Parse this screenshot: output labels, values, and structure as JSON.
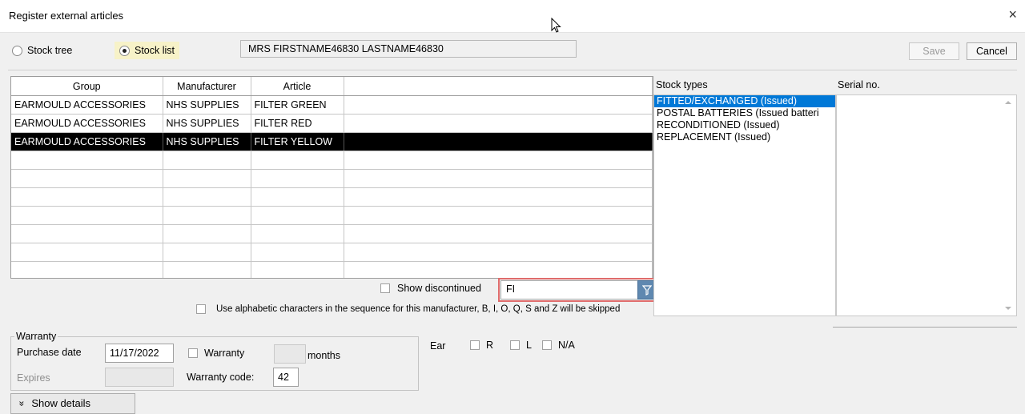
{
  "window": {
    "title": "Register external articles",
    "close_icon": "×"
  },
  "view_options": {
    "stock_tree": "Stock tree",
    "stock_list": "Stock list",
    "selected": "stock_list"
  },
  "patient": "MRS FIRSTNAME46830 LASTNAME46830",
  "buttons": {
    "save": "Save",
    "cancel": "Cancel",
    "show_details": "Show details",
    "show_details_icon": "»"
  },
  "grid": {
    "headers": [
      "Group",
      "Manufacturer",
      "Article",
      ""
    ],
    "rows": [
      [
        "EARMOULD ACCESSORIES",
        "NHS SUPPLIES",
        "FILTER GREEN",
        ""
      ],
      [
        "EARMOULD ACCESSORIES",
        "NHS SUPPLIES",
        "FILTER RED",
        ""
      ],
      [
        "EARMOULD ACCESSORIES",
        "NHS SUPPLIES",
        "FILTER YELLOW",
        ""
      ]
    ],
    "selected_row": 2
  },
  "show_discontinued": "Show discontinued",
  "filter": {
    "value": "FI"
  },
  "alpha_seq": "Use alphabetic characters in the sequence for this manufacturer, B, I, O, Q, S and Z will be skipped",
  "stock_types": {
    "label": "Stock types",
    "items": [
      "FITTED/EXCHANGED (Issued)",
      "POSTAL BATTERIES (Issued batteri",
      "RECONDITIONED (Issued)",
      "REPLACEMENT (Issued)"
    ],
    "selected": 0
  },
  "serial": {
    "label": "Serial no."
  },
  "warranty": {
    "legend": "Warranty",
    "purchase_date_label": "Purchase date",
    "purchase_date": "11/17/2022",
    "warranty_label": "Warranty",
    "months_label": "months",
    "months_value": "",
    "expires_label": "Expires",
    "expires_value": "",
    "code_label": "Warranty code:",
    "code_value": "42"
  },
  "ear": {
    "label": "Ear",
    "r": "R",
    "l": "L",
    "na": "N/A"
  },
  "colors": {
    "selection": "#0078d7",
    "grid_selected": "#000000",
    "filter_highlight": "#e06c6c",
    "filter_button": "#5f88b0"
  }
}
